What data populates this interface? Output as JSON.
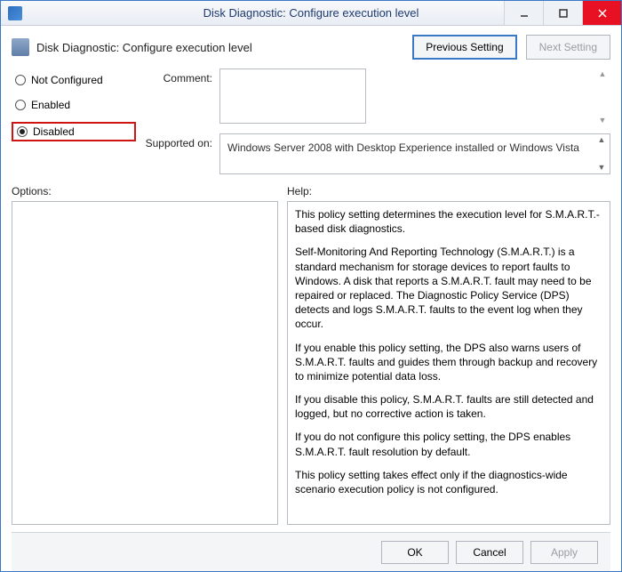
{
  "titlebar": {
    "title": "Disk Diagnostic: Configure execution level"
  },
  "header": {
    "title": "Disk Diagnostic: Configure execution level",
    "previous_setting": "Previous Setting",
    "next_setting": "Next Setting"
  },
  "radios": {
    "not_configured": "Not Configured",
    "enabled": "Enabled",
    "disabled": "Disabled",
    "selected": "disabled"
  },
  "fields": {
    "comment_label": "Comment:",
    "comment_value": "",
    "supported_label": "Supported on:",
    "supported_value": "Windows Server 2008 with Desktop Experience installed or Windows Vista"
  },
  "panels": {
    "options_label": "Options:",
    "help_label": "Help:",
    "help_paragraphs": [
      "This policy setting determines the execution level for S.M.A.R.T.-based disk diagnostics.",
      "Self-Monitoring And Reporting Technology (S.M.A.R.T.) is a standard mechanism for storage devices to report faults to Windows. A disk that reports a S.M.A.R.T. fault may need to be repaired or replaced. The Diagnostic Policy Service (DPS) detects and logs S.M.A.R.T. faults to the event log when they occur.",
      "If you enable this policy setting, the DPS also warns users of S.M.A.R.T. faults and guides them through backup and recovery to minimize potential data loss.",
      "If you disable this policy, S.M.A.R.T. faults are still detected and logged, but no corrective action is taken.",
      "If you do not configure this policy setting, the DPS enables S.M.A.R.T. fault resolution by default.",
      "This policy setting takes effect only if the diagnostics-wide scenario execution policy is not configured."
    ]
  },
  "footer": {
    "ok": "OK",
    "cancel": "Cancel",
    "apply": "Apply"
  }
}
